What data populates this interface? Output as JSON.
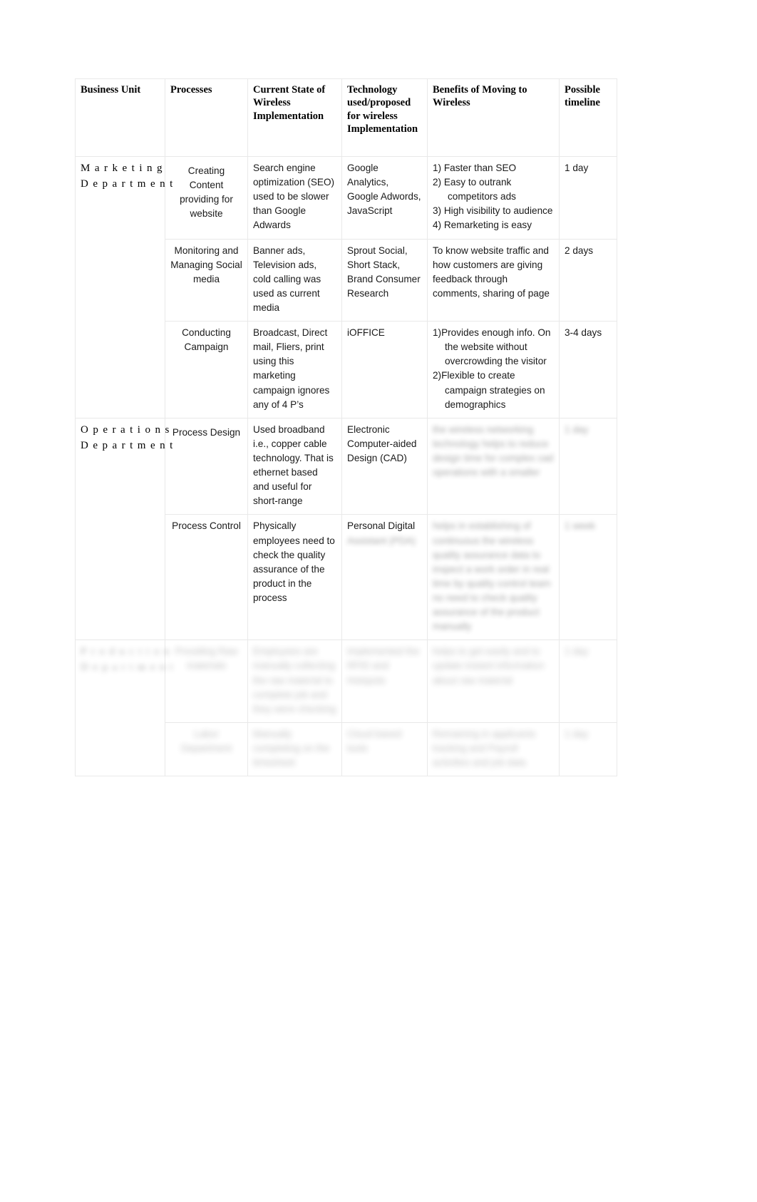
{
  "document": {
    "type": "table",
    "legibility_note": "lower portion of table is blurred and illegible"
  },
  "table": {
    "headers": [
      "Business Unit",
      "Processes",
      "Current State of Wireless Implementation",
      "Technology used/proposed for wireless Implementation",
      "Benefits of Moving to Wireless",
      "Possible timeline"
    ],
    "units": [
      {
        "id": "marketing",
        "label": "Marketing Department",
        "legible": true
      },
      {
        "id": "operations",
        "label": "Operations Department",
        "legible": true
      },
      {
        "id": "unit3",
        "label": "",
        "legible": false
      }
    ],
    "rows": [
      {
        "unit": "Marketing Department",
        "process": "Creating Content providing for website",
        "current_state": "Search engine optimization (SEO) used to be slower than Google Adwards",
        "technology": "Google Analytics, Google Adwords, JavaScript",
        "benefits": [
          "1) Faster than SEO",
          "2) Easy to outrank competitors ads",
          "3) High visibility to audience",
          "4) Remarketing is easy"
        ],
        "timeline": "1 day",
        "legible": true
      },
      {
        "unit": "Marketing Department",
        "process": "Monitoring and Managing Social media",
        "current_state": "Banner ads, Television ads, cold calling was used as current media",
        "technology": "Sprout Social, Short Stack, Brand Consumer Research",
        "benefits": [
          "To know website traffic and how customers are giving feedback through comments, sharing of page"
        ],
        "timeline": "2 days",
        "legible": true
      },
      {
        "unit": "Marketing Department",
        "process": "Conducting Campaign",
        "current_state": "Broadcast, Direct mail, Fliers, print using this marketing campaign ignores any of 4 P’s",
        "technology": "iOFFICE",
        "benefits": [
          "1)Provides enough info. On the website without overcrowding the visitor",
          "2)Flexible to create campaign strategies on demographics"
        ],
        "timeline": "3-4 days",
        "legible": true
      },
      {
        "unit": "Operations Department",
        "process": "Process Design",
        "current_state": "Used broadband i.e., copper cable technology. That is ethernet based and useful for short-range",
        "technology": "Electronic Computer-aided Design (CAD)",
        "benefits": [],
        "benefits_blurred": "the wireless networking technology helps to reduce design time for complex cad operations with a smaller",
        "timeline": "",
        "timeline_blurred": "1 day",
        "legible": false
      },
      {
        "unit": "Operations Department",
        "process": "Process Control",
        "current_state": "Physically employees need to check the quality assurance of the product in the process",
        "technology": "Personal Digital",
        "technology_blurred": "Assistant (PDA)",
        "benefits": [],
        "benefits_blurred": "helps in establishing of continuous the wireless quality assurance data to inspect a work order in real time by quality control team no need to check quality assurance of the product manually",
        "timeline": "",
        "timeline_blurred": "1 week",
        "legible": false
      },
      {
        "unit": "",
        "unit_blurred": "Production Department",
        "process": "",
        "process_blurred": "Providing Raw materials",
        "current_state": "",
        "current_state_blurred": "Employees are manually collecting the raw material to complete job and they were checking",
        "technology": "",
        "technology_blurred": "Implemented the RFID and Hotspots",
        "benefits": [],
        "benefits_blurred": "helps to get easily and to update instant information about raw material",
        "timeline": "",
        "timeline_blurred": "1 day",
        "legible": false
      },
      {
        "unit": "",
        "process": "",
        "process_blurred": "Labor Department",
        "current_state": "",
        "current_state_blurred": "Manually completing on the timesheet",
        "technology": "",
        "technology_blurred": "Cloud based tools",
        "benefits": [],
        "benefits_blurred": "Remaining in applicants tracking and Payroll activities and job data",
        "timeline": "",
        "timeline_blurred": "1 day",
        "legible": false
      }
    ]
  }
}
